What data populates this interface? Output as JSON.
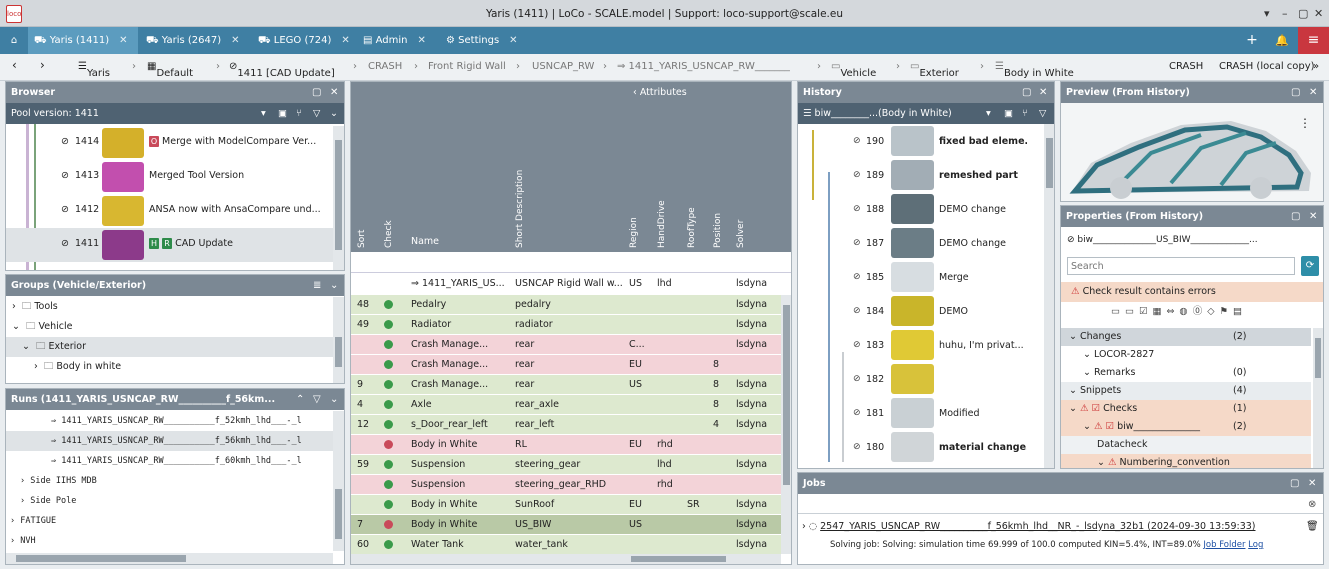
{
  "window": {
    "title": "Yaris (1411) | LoCo - SCALE.model | Support: loco-support@scale.eu",
    "logo_text": "loco"
  },
  "tabs": [
    {
      "label": "Yaris (1411)"
    },
    {
      "label": "Yaris (2647)"
    },
    {
      "label": "LEGO (724)"
    },
    {
      "label": "Admin"
    },
    {
      "label": "Settings"
    }
  ],
  "breadcrumb": {
    "items": [
      "Yaris",
      "Default",
      "1411 [CAD Update]",
      "CRASH",
      "Front Rigid Wall",
      "USNCAP_RW",
      "⇒ 1411_YARIS_USNCAP_RW_______",
      "Vehicle",
      "Exterior",
      "Body in White"
    ],
    "right": [
      "CRASH",
      "CRASH (local copy)"
    ]
  },
  "browser": {
    "title": "Browser",
    "pool_label": "Pool version: 1411",
    "items": [
      {
        "num": "1414",
        "badge": "O",
        "label": "Merge with ModelCompare Ver..."
      },
      {
        "num": "1413",
        "badge": "",
        "label": "Merged Tool Version"
      },
      {
        "num": "1412",
        "badge": "",
        "label": "ANSA now with AnsaCompare und..."
      },
      {
        "num": "1411",
        "badge": "H R",
        "label": "CAD Update"
      }
    ]
  },
  "groups": {
    "title": "Groups (Vehicle/Exterior)",
    "items": [
      "Tools",
      "Vehicle",
      "Exterior",
      "Body in white"
    ]
  },
  "runs": {
    "title": "Runs (1411_YARIS_USNCAP_RW__________f_56km...",
    "items": [
      "⇒ 1411_YARIS_USNCAP_RW__________f_52kmh_lhd___-_l",
      "⇒ 1411_YARIS_USNCAP_RW__________f_56kmh_lhd___-_l",
      "⇒ 1411_YARIS_USNCAP_RW__________f_60kmh_lhd___-_l",
      "Side IIHS MDB",
      "Side Pole",
      "FATIGUE",
      "NVH"
    ]
  },
  "grid": {
    "attributes_label": "Attributes",
    "columns": [
      "Sort",
      "Check",
      "Name",
      "Short Description",
      "Region",
      "HandDrive",
      "RoofType",
      "Position",
      "Solver"
    ],
    "filter_row": {
      "name": "⇒ 1411_YARIS_US...",
      "desc": "USNCAP Rigid Wall w...",
      "region": "US",
      "hand": "lhd",
      "solver": "lsdyna"
    },
    "rows": [
      {
        "sort": "48",
        "status": "ok",
        "name": "Pedalry",
        "desc": "pedalry",
        "region": "",
        "hand": "",
        "roof": "",
        "pos": "",
        "solver": "lsdyna"
      },
      {
        "sort": "49",
        "status": "ok",
        "name": "Radiator",
        "desc": "radiator",
        "region": "",
        "hand": "",
        "roof": "",
        "pos": "",
        "solver": "lsdyna"
      },
      {
        "sort": "",
        "status": "ok",
        "name": "Crash Manage...",
        "desc": "rear",
        "region": "C...",
        "hand": "",
        "roof": "",
        "pos": "",
        "solver": "lsdyna"
      },
      {
        "sort": "",
        "status": "ok",
        "name": "Crash Manage...",
        "desc": "rear",
        "region": "EU",
        "hand": "",
        "roof": "",
        "pos": "8",
        "solver": ""
      },
      {
        "sort": "9",
        "status": "ok",
        "name": "Crash Manage...",
        "desc": "rear",
        "region": "US",
        "hand": "",
        "roof": "",
        "pos": "8",
        "solver": "lsdyna"
      },
      {
        "sort": "4",
        "status": "ok",
        "name": "Axle",
        "desc": "rear_axle",
        "region": "",
        "hand": "",
        "roof": "",
        "pos": "8",
        "solver": "lsdyna"
      },
      {
        "sort": "12",
        "status": "ok",
        "name": "s_Door_rear_left",
        "desc": "rear_left",
        "region": "",
        "hand": "",
        "roof": "",
        "pos": "4",
        "solver": "lsdyna"
      },
      {
        "sort": "",
        "status": "bad",
        "name": "Body in White",
        "desc": "RL",
        "region": "EU",
        "hand": "rhd",
        "roof": "",
        "pos": "",
        "solver": ""
      },
      {
        "sort": "59",
        "status": "ok",
        "name": "Suspension",
        "desc": "steering_gear",
        "region": "",
        "hand": "lhd",
        "roof": "",
        "pos": "",
        "solver": "lsdyna"
      },
      {
        "sort": "",
        "status": "ok",
        "name": "Suspension",
        "desc": "steering_gear_RHD",
        "region": "",
        "hand": "rhd",
        "roof": "",
        "pos": "",
        "solver": ""
      },
      {
        "sort": "",
        "status": "ok",
        "name": "Body in White",
        "desc": "SunRoof",
        "region": "EU",
        "hand": "",
        "roof": "SR",
        "pos": "",
        "solver": "lsdyna"
      },
      {
        "sort": "7",
        "status": "bad",
        "name": "Body in White",
        "desc": "US_BIW",
        "region": "US",
        "hand": "",
        "roof": "",
        "pos": "",
        "solver": "lsdyna"
      },
      {
        "sort": "60",
        "status": "ok",
        "name": "Water Tank",
        "desc": "water_tank",
        "region": "",
        "hand": "",
        "roof": "",
        "pos": "",
        "solver": "lsdyna"
      }
    ]
  },
  "history": {
    "title": "History",
    "filter": "biw________...(Body in White)",
    "items": [
      {
        "num": "190",
        "label": "fixed bad eleme...",
        "bold": true
      },
      {
        "num": "189",
        "label": "remeshed part",
        "bold": true
      },
      {
        "num": "188",
        "label": "DEMO change",
        "bold": false
      },
      {
        "num": "187",
        "label": "DEMO change",
        "bold": false
      },
      {
        "num": "185",
        "label": "Merge",
        "bold": false
      },
      {
        "num": "184",
        "label": "DEMO",
        "bold": false
      },
      {
        "num": "183",
        "label": "huhu, I'm privat...",
        "bold": false
      },
      {
        "num": "182",
        "label": "",
        "bold": false
      },
      {
        "num": "181",
        "label": "Modified",
        "bold": false
      },
      {
        "num": "180",
        "label": "material change...",
        "bold": true
      }
    ]
  },
  "preview": {
    "title": "Preview (From History)"
  },
  "properties": {
    "title": "Properties (From History)",
    "id_label": "biw______________US_BIW_____________...",
    "search_placeholder": "Search",
    "warning": "Check result contains errors",
    "rows": [
      {
        "label": "Changes",
        "value": "(2)",
        "indent": 0
      },
      {
        "label": "LOCOR-2827",
        "value": "",
        "indent": 1
      },
      {
        "label": "Remarks",
        "value": "(0)",
        "indent": 1
      },
      {
        "label": "Snippets",
        "value": "(4)",
        "indent": 0
      },
      {
        "label": "Checks",
        "value": "(1)",
        "indent": 0
      },
      {
        "label": "biw______________",
        "value": "(2)",
        "indent": 1
      },
      {
        "label": "Datacheck",
        "value": "",
        "indent": 2
      },
      {
        "label": "Numbering_convention",
        "value": "",
        "indent": 2
      }
    ]
  },
  "jobs": {
    "title": "Jobs",
    "job": "2547_YARIS_USNCAP_RW__________f_56kmh_lhd__NR_-_lsdyna_32b1 (2024-09-30 13:59:33)",
    "status_prefix": "Solving job: Solving: simulation time 69.999 of 100.0 computed KIN=5.4%, INT=89.0%",
    "link1": "Job Folder",
    "link2": "Log"
  },
  "colors": {
    "tab_bar": "#3f7fa3",
    "panel_head": "#7b8894",
    "row_green": "#dde9cf",
    "row_red": "#f3d3d8",
    "warning_bg": "#f5d9c8"
  }
}
